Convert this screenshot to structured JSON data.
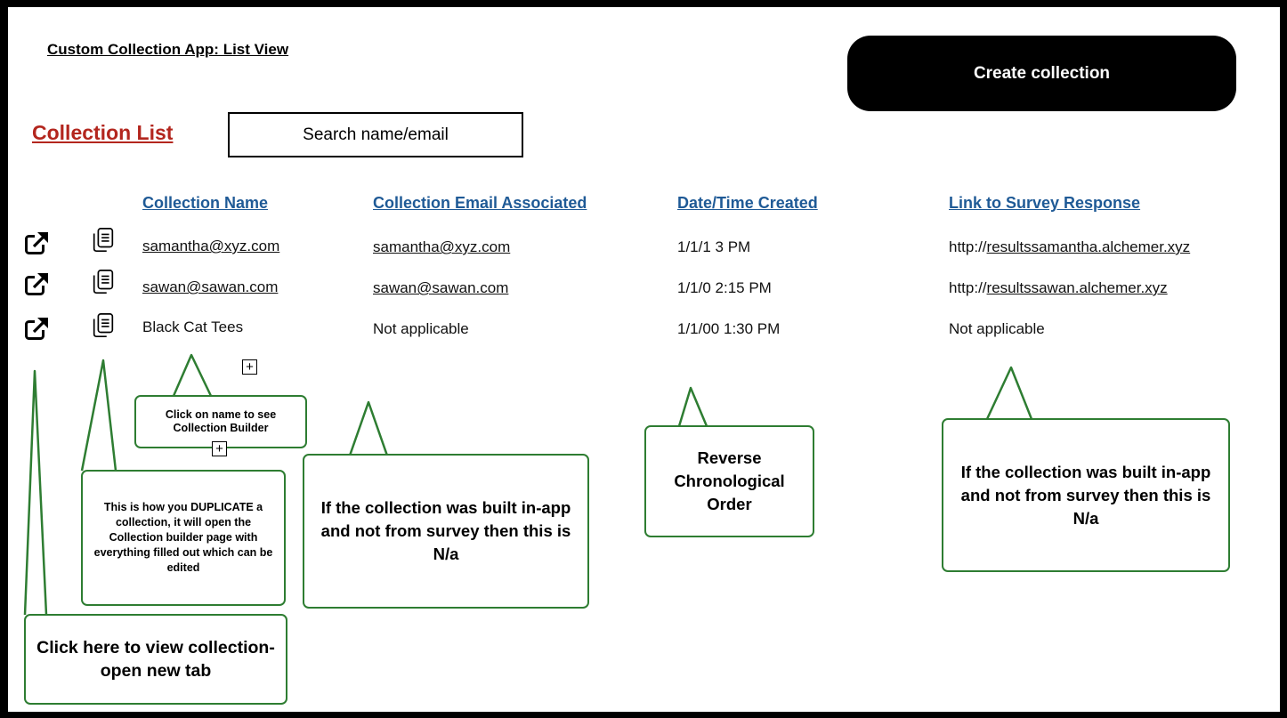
{
  "app": {
    "title": "Custom Collection App: List View",
    "create_button_label": "Create collection"
  },
  "list": {
    "heading": "Collection List",
    "search_placeholder": "Search name/email"
  },
  "table": {
    "columns": [
      "Collection Name",
      "Collection Email Associated",
      "Date/Time Created",
      "Link to Survey Response"
    ],
    "rows": [
      {
        "name": "samantha@xyz.com",
        "email": "samantha@xyz.com",
        "created": "1/1/1 3 PM",
        "link_prefix": "http://",
        "link_host": "resultssamantha.alchemer.xyz"
      },
      {
        "name": "sawan@sawan.com",
        "email": "sawan@sawan.com",
        "created": "1/1/0 2:15 PM",
        "link_prefix": "http://",
        "link_host": "resultssawan.alchemer.xyz"
      },
      {
        "name": "Black Cat Tees",
        "email": "Not applicable",
        "created": "1/1/00 1:30 PM",
        "link": "Not applicable"
      }
    ]
  },
  "callouts": {
    "name_note": "Click on name to see Collection Builder",
    "duplicate_note": "This is how you DUPLICATE a collection, it will open the Collection builder page with everything filled out which can be edited",
    "email_na_note": "If the collection was built in-app and not from survey then this is N/a",
    "date_order_note": "Reverse Chronological Order",
    "link_na_note": "If the collection was built in-app and not from survey then this is N/a",
    "view_note": "Click here to view collection- open new tab"
  },
  "colors": {
    "heading_red": "#b3261e",
    "header_link_blue": "#1f5a96",
    "callout_green": "#2e7d32",
    "button_black": "#000000"
  }
}
